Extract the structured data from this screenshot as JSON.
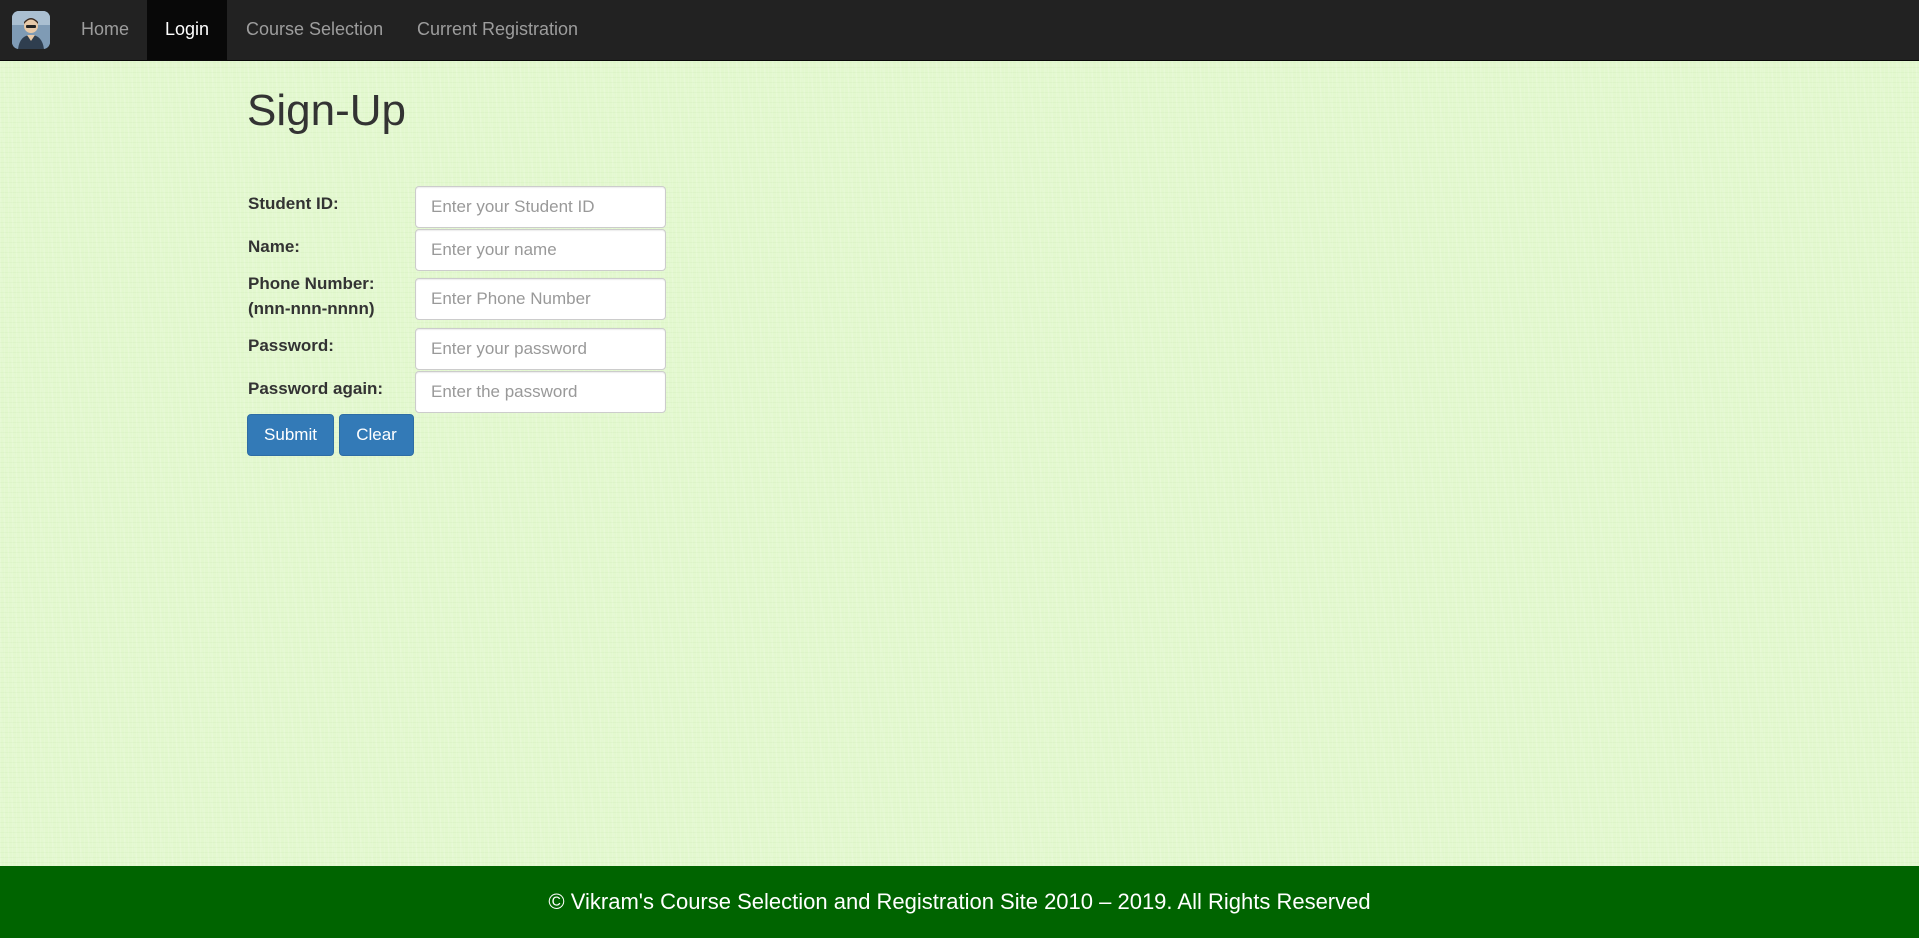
{
  "nav": {
    "brand_icon": "user-avatar-logo",
    "items": [
      {
        "label": "Home",
        "active": false
      },
      {
        "label": "Login",
        "active": true
      },
      {
        "label": "Course Selection",
        "active": false
      },
      {
        "label": "Current Registration",
        "active": false
      }
    ]
  },
  "main": {
    "title": "Sign-Up",
    "fields": [
      {
        "label": "Student ID:",
        "label_line2": "",
        "placeholder": "Enter your Student ID",
        "value": ""
      },
      {
        "label": "Name:",
        "label_line2": "",
        "placeholder": "Enter your name",
        "value": ""
      },
      {
        "label": "Phone Number:",
        "label_line2": "(nnn-nnn-nnnn)",
        "placeholder": "Enter Phone Number",
        "value": ""
      },
      {
        "label": "Password:",
        "label_line2": "",
        "placeholder": "Enter your password",
        "value": ""
      },
      {
        "label": "Password again:",
        "label_line2": "",
        "placeholder": "Enter the password",
        "value": ""
      }
    ],
    "submit_label": "Submit",
    "clear_label": "Clear"
  },
  "footer": {
    "text": "© Vikram's Course Selection and Registration Site 2010 – 2019. All Rights Reserved"
  },
  "colors": {
    "navbar_bg": "#222222",
    "nav_active_bg": "#080808",
    "page_bg": "#e3f8cf",
    "button_bg": "#337ab7",
    "footer_bg": "#006400"
  }
}
